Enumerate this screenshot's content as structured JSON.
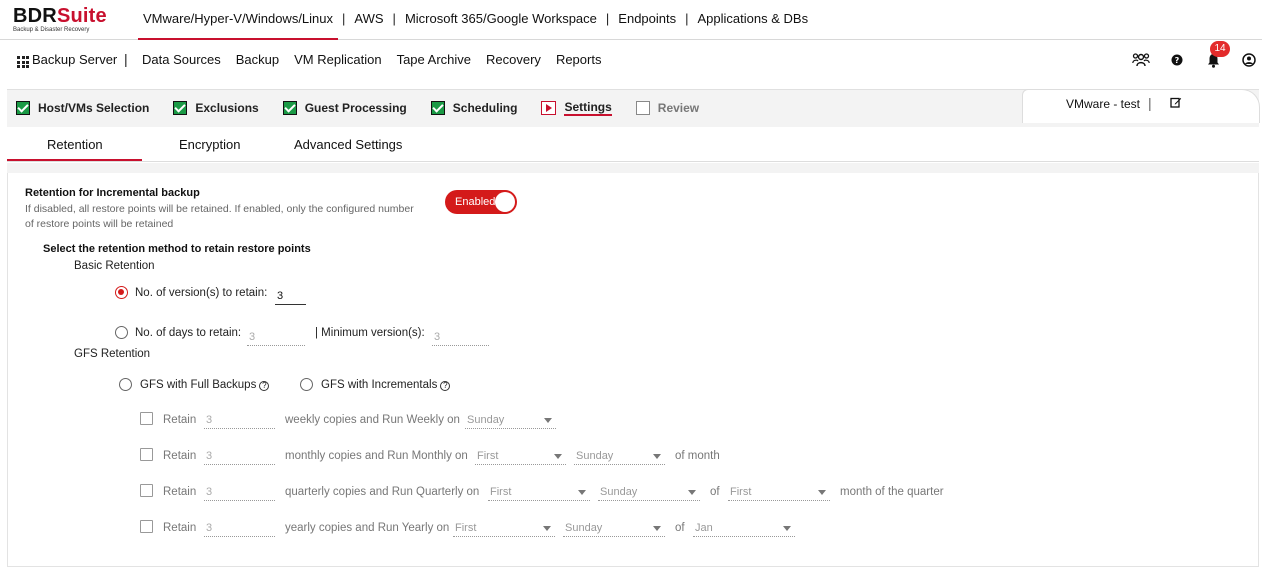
{
  "brand": {
    "name_bold": "BDR",
    "name_red": "Suite",
    "tagline": "Backup & Disaster Recovery"
  },
  "top_nav": {
    "items": [
      "VMware/Hyper-V/Windows/Linux",
      "AWS",
      "Microsoft 365/Google Workspace",
      "Endpoints",
      "Applications & DBs"
    ],
    "separator": "|"
  },
  "main_nav": {
    "server_label": "Backup Server",
    "pipe": "|",
    "items": [
      "Data Sources",
      "Backup",
      "VM Replication",
      "Tape Archive",
      "Recovery",
      "Reports"
    ]
  },
  "header_icons": {
    "notification_count": "14",
    "icons": [
      "users-icon",
      "help-icon",
      "bell-icon",
      "user-account-icon"
    ]
  },
  "wizard_steps": [
    {
      "label": "Host/VMs Selection",
      "state": "done"
    },
    {
      "label": "Exclusions",
      "state": "done"
    },
    {
      "label": "Guest Processing",
      "state": "done"
    },
    {
      "label": "Scheduling",
      "state": "done"
    },
    {
      "label": "Settings",
      "state": "current"
    },
    {
      "label": "Review",
      "state": "pending"
    }
  ],
  "backup_job": {
    "name": "VMware - test",
    "separator": "|"
  },
  "sub_tabs": [
    "Retention",
    "Encryption",
    "Advanced Settings"
  ],
  "retention": {
    "title": "Retention for Incremental backup",
    "help_line1": "If disabled, all restore points will be retained. If enabled, only the configured number",
    "help_line2": "of restore points will be retained",
    "toggle_label": "Enabled",
    "method_heading": "Select the retention method to retain restore points",
    "basic_heading": "Basic Retention",
    "versions_label": "No. of version(s) to retain:",
    "versions_value": "3",
    "days_label": "No. of days to retain:",
    "days_value": "3",
    "min_versions_label": "| Minimum version(s):",
    "min_versions_value": "3",
    "gfs_heading": "GFS Retention",
    "gfs_full_label": "GFS with Full Backups",
    "gfs_incr_label": "GFS with Incrementals",
    "help_glyph": "?"
  },
  "gfs_rows": {
    "weekly": {
      "retain": "Retain",
      "copies": "3",
      "text": "weekly copies and Run Weekly on",
      "day": "Sunday"
    },
    "monthly": {
      "retain": "Retain",
      "copies": "3",
      "text": "monthly copies and Run Monthly on",
      "week": "First",
      "day": "Sunday",
      "suffix": "of month"
    },
    "quarterly": {
      "retain": "Retain",
      "copies": "3",
      "text": "quarterly copies and Run Quarterly on",
      "week": "First",
      "day": "Sunday",
      "of": "of",
      "month_week": "First",
      "suffix": "month of the quarter"
    },
    "yearly": {
      "retain": "Retain",
      "copies": "3",
      "text": "yearly copies and Run Yearly on",
      "week": "First",
      "day": "Sunday",
      "of": "of",
      "month": "Jan"
    }
  }
}
